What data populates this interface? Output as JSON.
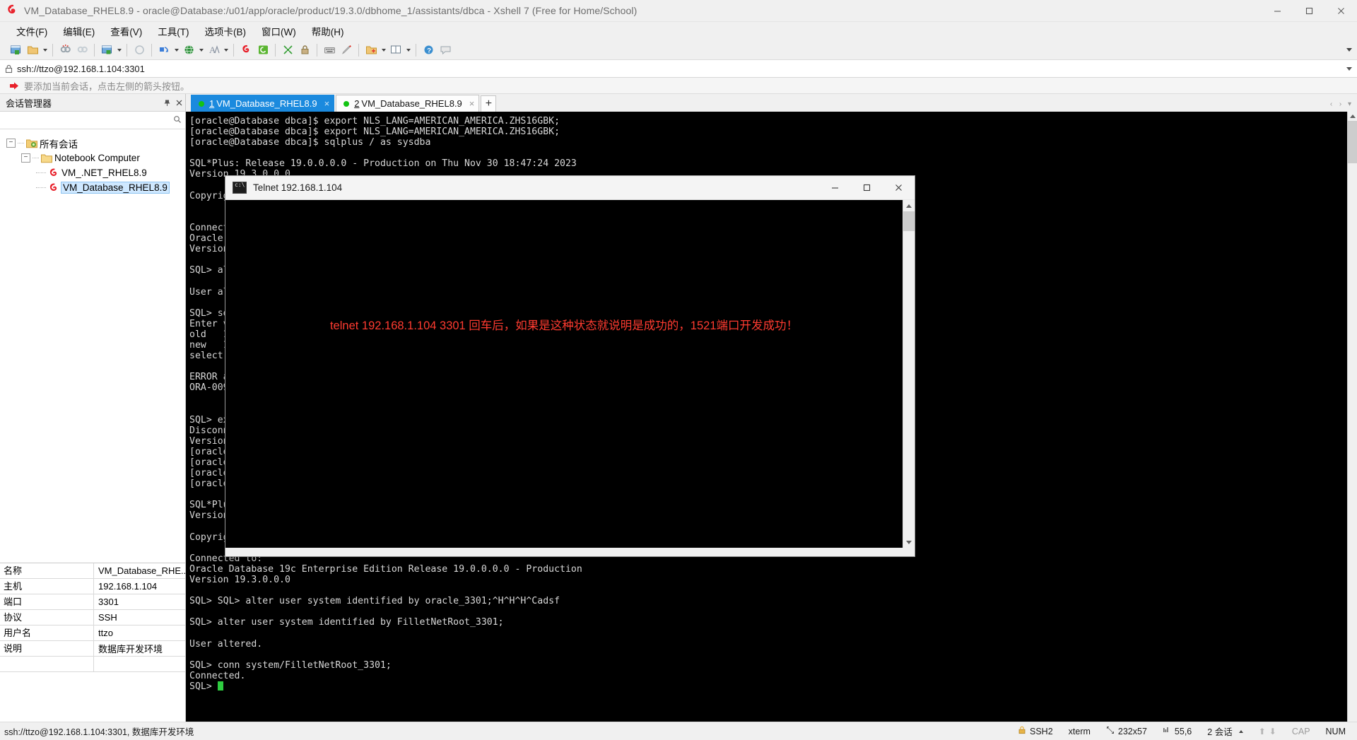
{
  "window": {
    "title": "VM_Database_RHEL8.9 - oracle@Database:/u01/app/oracle/product/19.3.0/dbhome_1/assistants/dbca - Xshell 7 (Free for Home/School)",
    "minimize": "─",
    "maximize": "□",
    "close": "✕"
  },
  "menubar": {
    "items": [
      {
        "label": "文件(F)",
        "name": "menu-file"
      },
      {
        "label": "编辑(E)",
        "name": "menu-edit"
      },
      {
        "label": "查看(V)",
        "name": "menu-view"
      },
      {
        "label": "工具(T)",
        "name": "menu-tools"
      },
      {
        "label": "选项卡(B)",
        "name": "menu-tabs"
      },
      {
        "label": "窗口(W)",
        "name": "menu-window"
      },
      {
        "label": "帮助(H)",
        "name": "menu-help"
      }
    ]
  },
  "addressbar": {
    "value": "ssh://ttzo@192.168.1.104:3301",
    "icon": "lock-icon"
  },
  "notice": {
    "text": "要添加当前会话，点击左侧的箭头按钮。"
  },
  "sidebar": {
    "title": "会话管理器",
    "tree": [
      {
        "label": "所有会话",
        "level": 0,
        "icon": "folder-gear-icon",
        "expander": "−",
        "selected": false
      },
      {
        "label": "Notebook Computer",
        "level": 1,
        "icon": "folder-icon",
        "expander": "−",
        "selected": false
      },
      {
        "label": "VM_.NET_RHEL8.9",
        "level": 2,
        "icon": "session-icon",
        "expander": "",
        "selected": false
      },
      {
        "label": "VM_Database_RHEL8.9",
        "level": 2,
        "icon": "session-icon",
        "expander": "",
        "selected": true
      }
    ],
    "properties": [
      {
        "key": "名称",
        "value": "VM_Database_RHE..."
      },
      {
        "key": "主机",
        "value": "192.168.1.104"
      },
      {
        "key": "端口",
        "value": "3301"
      },
      {
        "key": "协议",
        "value": "SSH"
      },
      {
        "key": "用户名",
        "value": "ttzo"
      },
      {
        "key": "说明",
        "value": "数据库开发环境"
      }
    ]
  },
  "tabs": {
    "items": [
      {
        "num": "1",
        "label": "VM_Database_RHEL8.9",
        "active": true,
        "close": "×"
      },
      {
        "num": "2",
        "label": "VM_Database_RHEL8.9",
        "active": false,
        "close": "×"
      }
    ],
    "add_label": "+",
    "nav_left": "‹",
    "nav_right": "›",
    "nav_menu": "▾"
  },
  "terminal": {
    "lines_top": "[oracle@Database dbca]$ export NLS_LANG=AMERICAN_AMERICA.ZHS16GBK;\n[oracle@Database dbca]$ export NLS_LANG=AMERICAN_AMERICA.ZHS16GBK;\n[oracle@Database dbca]$ sqlplus / as sysdba\n\nSQL*Plus: Release 19.0.0.0.0 - Production on Thu Nov 30 18:47:24 2023\nVersion 19.3.0.0.0\n\nCopyrig\n\n\nConnect\nOracle\nVersion\n\nSQL> al\n\nUser al\n\nSQL> se\nEnter v\nold   1\nnew   1\nselect\n\nERROR a\nORA-009\n\n\nSQL> ex\nDisconn\nVersion\n[oracle\n[oracle\n[oracle\n[oracle\n\nSQL*Plu\nVersion\n\nCopyrig\n",
    "lines_bottom": "\nConnected to:\nOracle Database 19c Enterprise Edition Release 19.0.0.0.0 - Production\nVersion 19.3.0.0.0\n\nSQL> SQL> alter user system identified by oracle_3301;^H^H^H^Cadsf\n\nSQL> alter user system identified by FilletNetRoot_3301;\n\nUser altered.\n\nSQL> conn system/FilletNetRoot_3301;\nConnected.\nSQL> "
  },
  "telnet": {
    "title": "Telnet 192.168.1.104",
    "message": "telnet 192.168.1.104 3301 回车后，如果是这种状态就说明是成功的，1521端口开发成功！",
    "minimize": "─",
    "maximize": "□",
    "close": "✕",
    "message_color": "#ff3b30"
  },
  "statusbar": {
    "left": "ssh://ttzo@192.168.1.104:3301, 数据库开发环境",
    "security": "SSH2",
    "term_type": "xterm",
    "size": "232x57",
    "cursor": "55,6",
    "sessions": "2 会话",
    "up_arrow": "⬆",
    "down_arrow": "⬇",
    "caps": "CAP",
    "num": "NUM"
  }
}
